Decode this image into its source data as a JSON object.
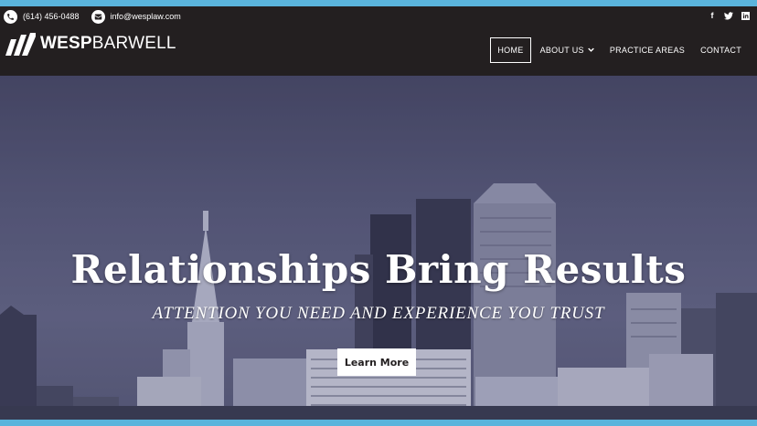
{
  "topbar": {
    "phone": "(614) 456-0488",
    "email": "info@wesplaw.com",
    "social": [
      "facebook-icon",
      "twitter-icon",
      "linkedin-icon"
    ]
  },
  "logo": {
    "part1": "WESP",
    "part2": "BARWELL"
  },
  "nav": {
    "home": "HOME",
    "about": "ABOUT US",
    "practice": "PRACTICE AREAS",
    "contact": "CONTACT"
  },
  "hero": {
    "headline": "Relationships Bring Results",
    "subline": "ATTENTION YOU NEED AND EXPERIENCE YOU TRUST",
    "cta": "Learn More"
  },
  "colors": {
    "accent": "#5ab4dc",
    "dark": "#231f20",
    "hero_tint": "#5a5c7c"
  }
}
